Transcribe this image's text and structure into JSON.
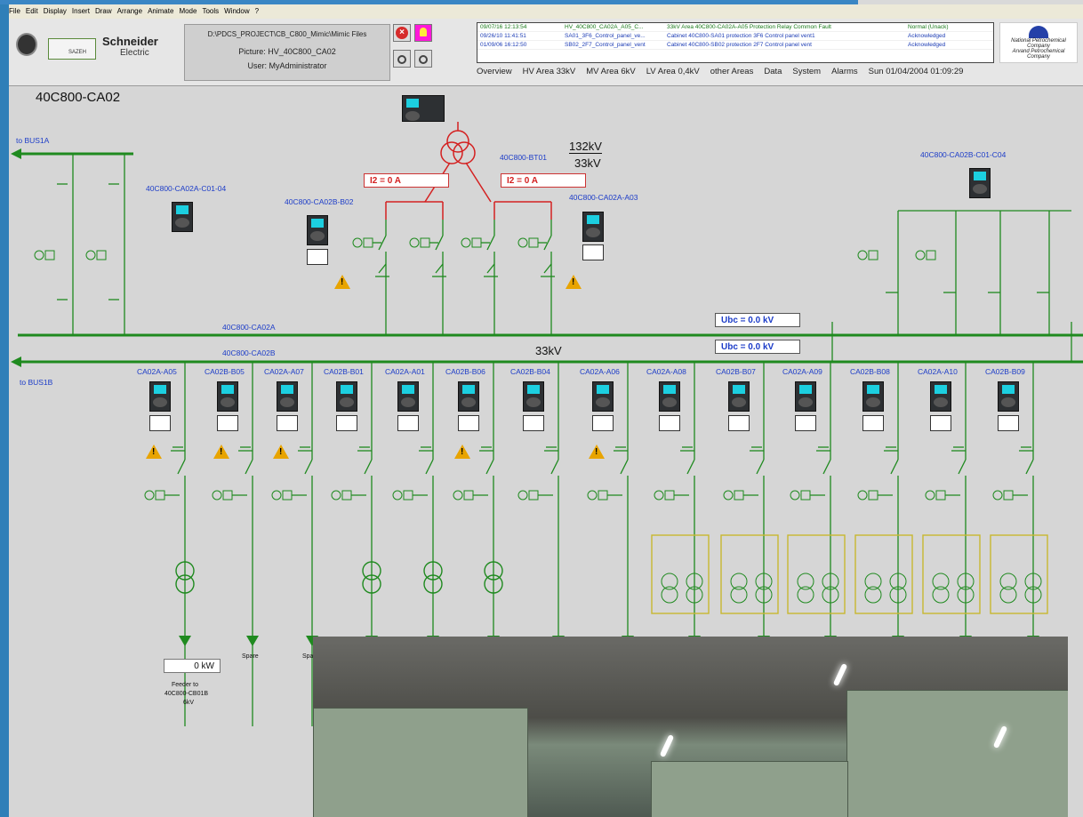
{
  "menu": [
    "File",
    "Edit",
    "Display",
    "Insert",
    "Draw",
    "Arrange",
    "Animate",
    "Mode",
    "Tools",
    "Window",
    "?"
  ],
  "header": {
    "schneider_line1": "Schneider",
    "schneider_line2": "Electric",
    "sazeh": "SAZEH",
    "path": "D:\\PDCS_PROJECT\\CB_C800_Mimic\\Mimic Files",
    "picture": "Picture: HV_40C800_CA02",
    "user": "User: MyAdministrator",
    "npc_line1": "National Petrochemical Company",
    "npc_line2": "Arvand Petrochemical Company"
  },
  "alarms": [
    {
      "time": "09/07/16 12:13:54",
      "tag": "HV_40C800_CA02A_A05_C...",
      "desc": "33kV Area 40C800-CA02A-A05 Protection Relay Common Fault",
      "state": "Normal (Unack)",
      "color": "#1a7a1a"
    },
    {
      "time": "09/26/10 11:41:51",
      "tag": "SA01_3F6_Control_panel_ve...",
      "desc": "Cabinet 40C800-SA01 protection 3F6 Control panel vent1",
      "state": "Acknowledged",
      "color": "#1c3cb5"
    },
    {
      "time": "01/09/06 16:12:50",
      "tag": "SB02_2F7_Control_panel_vent",
      "desc": "Cabinet 40C800-SB02 protection 2F7 Control panel vent",
      "state": "Acknowledged",
      "color": "#1c3cb5"
    }
  ],
  "nav": [
    "Overview",
    "HV Area 33kV",
    "MV Area 6kV",
    "LV Area 0,4kV",
    "other Areas",
    "Data",
    "System",
    "Alarms",
    "Sun 01/04/2004 01:09:29"
  ],
  "mimic": {
    "title": "40C800-CA02",
    "to_bus1a": "to BUS1A",
    "to_bus1b": "to BUS1B",
    "bus_a": "40C800-CA02A",
    "bus_b": "40C800-CA02B",
    "voltage": "33kV",
    "tr_name": "40C800-BT01",
    "tr_ratio_top": "132kV",
    "tr_ratio_bottom": "33kV",
    "i2_left": "I2 = 0 A",
    "i2_right": "I2 = 0 A",
    "ubc_a": "Ubc = 0.0 kV",
    "ubc_b": "Ubc = 0.0 kV",
    "relay_c01": "40C800-CA02A-C01-04",
    "relay_b02": "40C800-CA02B-B02",
    "relay_a03": "40C800-CA02A-A03",
    "relay_bc01": "40C800-CA02B-C01-C04",
    "feeders": [
      "CA02A-A05",
      "CA02B-B05",
      "CA02A-A07",
      "CA02B-B01",
      "CA02A-A01",
      "CA02B-B06",
      "CA02B-B04",
      "CA02A-A06",
      "CA02A-A08",
      "CA02B-B07",
      "CA02A-A09",
      "CA02B-B08",
      "CA02A-A10",
      "CA02B-B09"
    ],
    "power": "0 kW",
    "feeder_text_1": "Feeder to",
    "feeder_text_2": "40C800-CB01B",
    "feeder_text_3": "6kV",
    "spare_1": "Spare",
    "spare_2": "Spa"
  },
  "colors": {
    "line": "#1f8a1f",
    "red": "#d42020",
    "label": "#1c3cc8",
    "warn": "#e8a400"
  }
}
